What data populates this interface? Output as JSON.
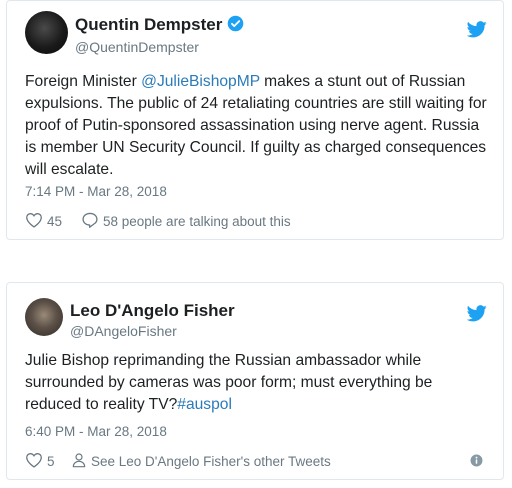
{
  "tweets": [
    {
      "name": "Quentin Dempster",
      "handle": "@QuentinDempster",
      "verified": true,
      "text_parts": [
        "Foreign Minister ",
        "@JulieBishopMP",
        " makes a stunt out of Russian expulsions. The public of 24 retaliating countries are still waiting for proof of Putin-sponsored assassination using nerve agent. Russia is member UN Security Council. If guilty as charged consequences will escalate."
      ],
      "timestamp": "7:14 PM - Mar 28, 2018",
      "likes": "45",
      "conversation": "58 people are talking about this"
    },
    {
      "name": "Leo D'Angelo Fisher",
      "handle": "@DAngeloFisher",
      "verified": false,
      "text_parts": [
        "Julie Bishop reprimanding the Russian ambassador while surrounded by cameras was poor form; must everything be reduced to reality TV?",
        "#auspol"
      ],
      "timestamp": "6:40 PM - Mar 28, 2018",
      "likes": "5",
      "profile_link": "See Leo D'Angelo Fisher's other Tweets"
    }
  ],
  "colors": {
    "link": "#2b7bb9",
    "twitter_blue": "#1da1f2",
    "muted": "#697882",
    "border": "#e1e8ed"
  },
  "icons": [
    "twitter-bird-icon",
    "verified-badge-icon",
    "heart-icon",
    "speech-bubble-icon",
    "person-icon",
    "info-icon"
  ]
}
